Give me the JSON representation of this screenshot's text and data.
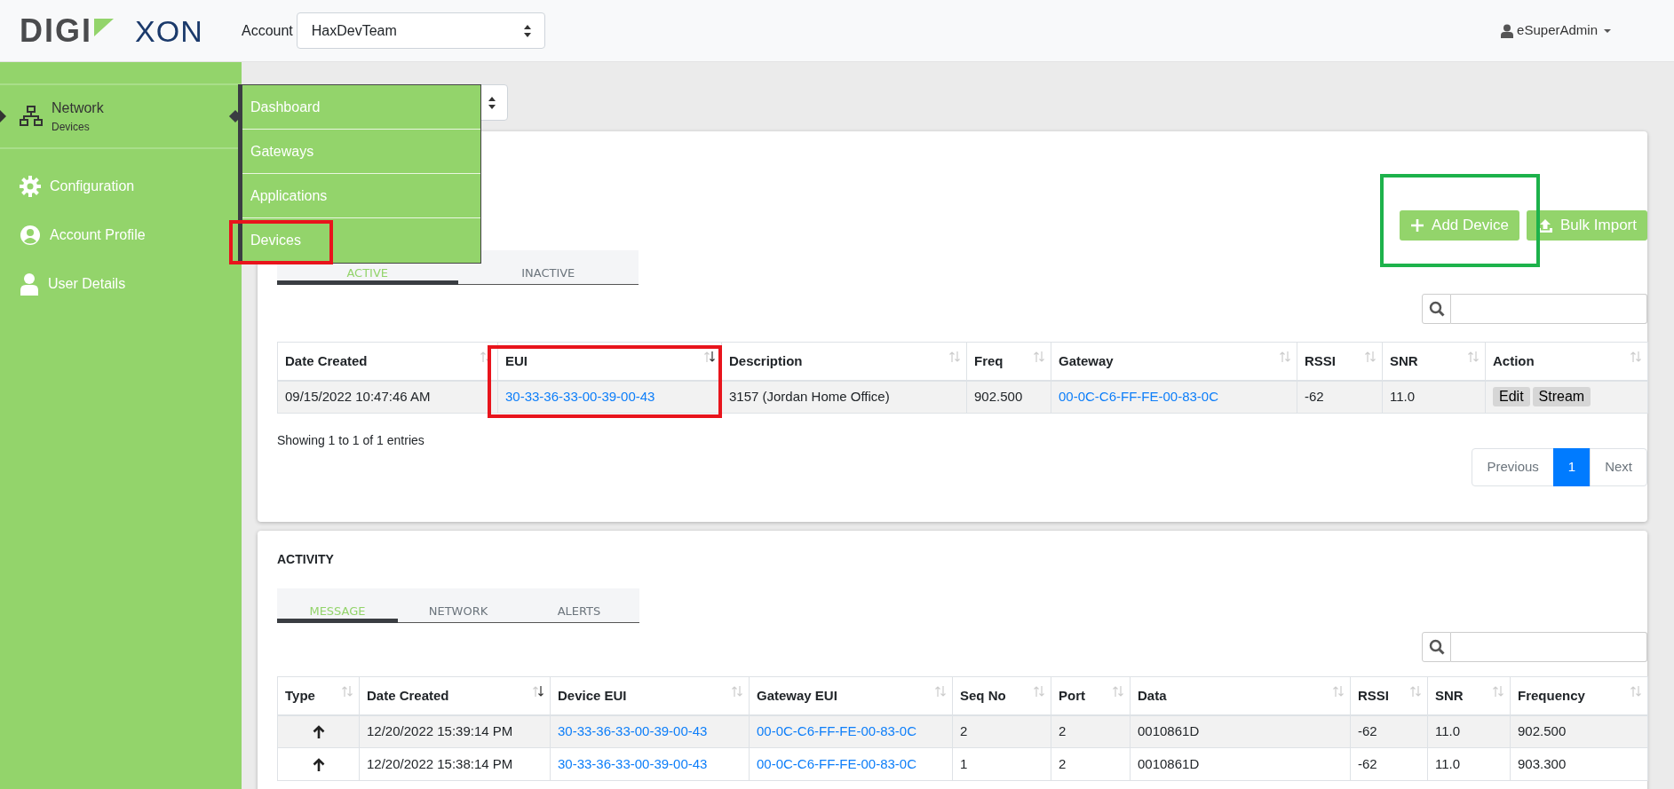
{
  "logo": {
    "brand": "DIGI",
    "product": "XON"
  },
  "account": {
    "label": "Account",
    "value": "HaxDevTeam"
  },
  "user_menu": {
    "label": "eSuperAdmin"
  },
  "sidebar": {
    "items": [
      {
        "kind": "network",
        "label": "Network",
        "sublabel": "Devices",
        "selected": true
      },
      {
        "kind": "gear",
        "label": "Configuration",
        "selected": false
      },
      {
        "kind": "profile",
        "label": "Account Profile",
        "selected": false
      },
      {
        "kind": "user",
        "label": "User Details",
        "selected": false
      }
    ]
  },
  "network_menu": {
    "items": [
      {
        "label": "Dashboard"
      },
      {
        "label": "Gateways"
      },
      {
        "label": "Applications"
      },
      {
        "label": "Devices",
        "highlighted": true
      }
    ]
  },
  "devices_card": {
    "buttons": [
      {
        "kind": "add",
        "label": "Add Device",
        "highlighted": true
      },
      {
        "kind": "upload",
        "label": "Bulk Import"
      }
    ],
    "tabs": [
      {
        "label": "ACTIVE",
        "selected": true
      },
      {
        "label": "INACTIVE",
        "selected": false
      }
    ],
    "table": {
      "columns": [
        {
          "label": "Date Created",
          "sorted": false
        },
        {
          "label": "EUI",
          "sorted": true,
          "highlighted": true
        },
        {
          "label": "Description",
          "sorted": false
        },
        {
          "label": "Freq",
          "sorted": false
        },
        {
          "label": "Gateway",
          "sorted": false
        },
        {
          "label": "RSSI",
          "sorted": false
        },
        {
          "label": "SNR",
          "sorted": false
        },
        {
          "label": "Action",
          "sorted": false
        }
      ],
      "rows": [
        {
          "cells": [
            {
              "kind": "text",
              "text": "09/15/2022 10:47:46 AM"
            },
            {
              "kind": "link",
              "text": "30-33-36-33-00-39-00-43"
            },
            {
              "kind": "text",
              "text": "3157 (Jordan Home Office)"
            },
            {
              "kind": "text",
              "text": "902.500"
            },
            {
              "kind": "link",
              "text": "00-0C-C6-FF-FE-00-83-0C"
            },
            {
              "kind": "text",
              "text": "-62"
            },
            {
              "kind": "text",
              "text": "11.0"
            },
            {
              "kind": "actions",
              "actions": [
                "Edit",
                "Stream"
              ]
            }
          ]
        }
      ]
    },
    "info": "Showing 1 to 1 of 1 entries",
    "pagination": [
      {
        "label": "Previous",
        "selected": false
      },
      {
        "label": "1",
        "selected": true
      },
      {
        "label": "Next",
        "selected": false
      }
    ]
  },
  "activity_card": {
    "title": "ACTIVITY",
    "tabs": [
      {
        "label": "MESSAGE",
        "selected": true
      },
      {
        "label": "NETWORK",
        "selected": false
      },
      {
        "label": "ALERTS",
        "selected": false
      }
    ],
    "table": {
      "columns": [
        {
          "label": "Type",
          "sorted": false
        },
        {
          "label": "Date Created",
          "sorted": true
        },
        {
          "label": "Device EUI",
          "sorted": false
        },
        {
          "label": "Gateway EUI",
          "sorted": false
        },
        {
          "label": "Seq No",
          "sorted": false
        },
        {
          "label": "Port",
          "sorted": false
        },
        {
          "label": "Data",
          "sorted": false
        },
        {
          "label": "RSSI",
          "sorted": false
        },
        {
          "label": "SNR",
          "sorted": false
        },
        {
          "label": "Frequency",
          "sorted": false
        }
      ],
      "rows": [
        {
          "cells": [
            {
              "kind": "up"
            },
            {
              "kind": "text",
              "text": "12/20/2022 15:39:14 PM"
            },
            {
              "kind": "link",
              "text": "30-33-36-33-00-39-00-43"
            },
            {
              "kind": "link",
              "text": "00-0C-C6-FF-FE-00-83-0C"
            },
            {
              "kind": "text",
              "text": "2"
            },
            {
              "kind": "text",
              "text": "2"
            },
            {
              "kind": "text",
              "text": "0010861D"
            },
            {
              "kind": "text",
              "text": "-62"
            },
            {
              "kind": "text",
              "text": "11.0"
            },
            {
              "kind": "text",
              "text": "902.500"
            }
          ]
        },
        {
          "cells": [
            {
              "kind": "up"
            },
            {
              "kind": "text",
              "text": "12/20/2022 15:38:14 PM"
            },
            {
              "kind": "link",
              "text": "30-33-36-33-00-39-00-43"
            },
            {
              "kind": "link",
              "text": "00-0C-C6-FF-FE-00-83-0C"
            },
            {
              "kind": "text",
              "text": "1"
            },
            {
              "kind": "text",
              "text": "2"
            },
            {
              "kind": "text",
              "text": "0010861D"
            },
            {
              "kind": "text",
              "text": "-62"
            },
            {
              "kind": "text",
              "text": "11.0"
            },
            {
              "kind": "text",
              "text": "903.300"
            }
          ]
        }
      ]
    }
  }
}
